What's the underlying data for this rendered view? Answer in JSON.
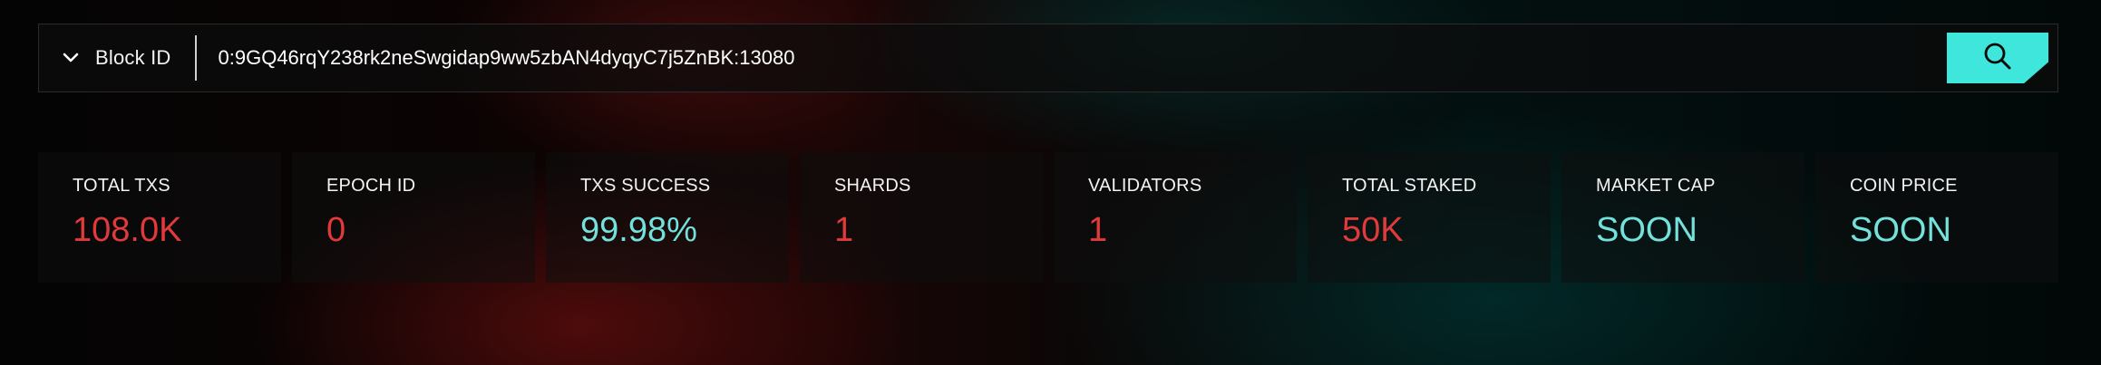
{
  "search": {
    "selector_label": "Block ID",
    "selector_icon": "chevron-down-icon",
    "value": "0:9GQ46rqY238rk2neSwgidap9ww5zbAN4dyqyC7j5ZnBK:13080",
    "button_icon": "search-icon",
    "button_color": "#3ee6dc"
  },
  "stats": [
    {
      "label": "TOTAL TXS",
      "value": "108.0K",
      "color": "#e13a3a"
    },
    {
      "label": "EPOCH ID",
      "value": "0",
      "color": "#e13a3a"
    },
    {
      "label": "TXS SUCCESS",
      "value": "99.98%",
      "color": "#74e2dc"
    },
    {
      "label": "SHARDS",
      "value": "1",
      "color": "#e13a3a"
    },
    {
      "label": "VALIDATORS",
      "value": "1",
      "color": "#e13a3a"
    },
    {
      "label": "TOTAL STAKED",
      "value": "50K",
      "color": "#e13a3a"
    },
    {
      "label": "MARKET CAP",
      "value": "SOON",
      "color": "#74e2dc"
    },
    {
      "label": "COIN PRICE",
      "value": "SOON",
      "color": "#74e2dc"
    }
  ]
}
